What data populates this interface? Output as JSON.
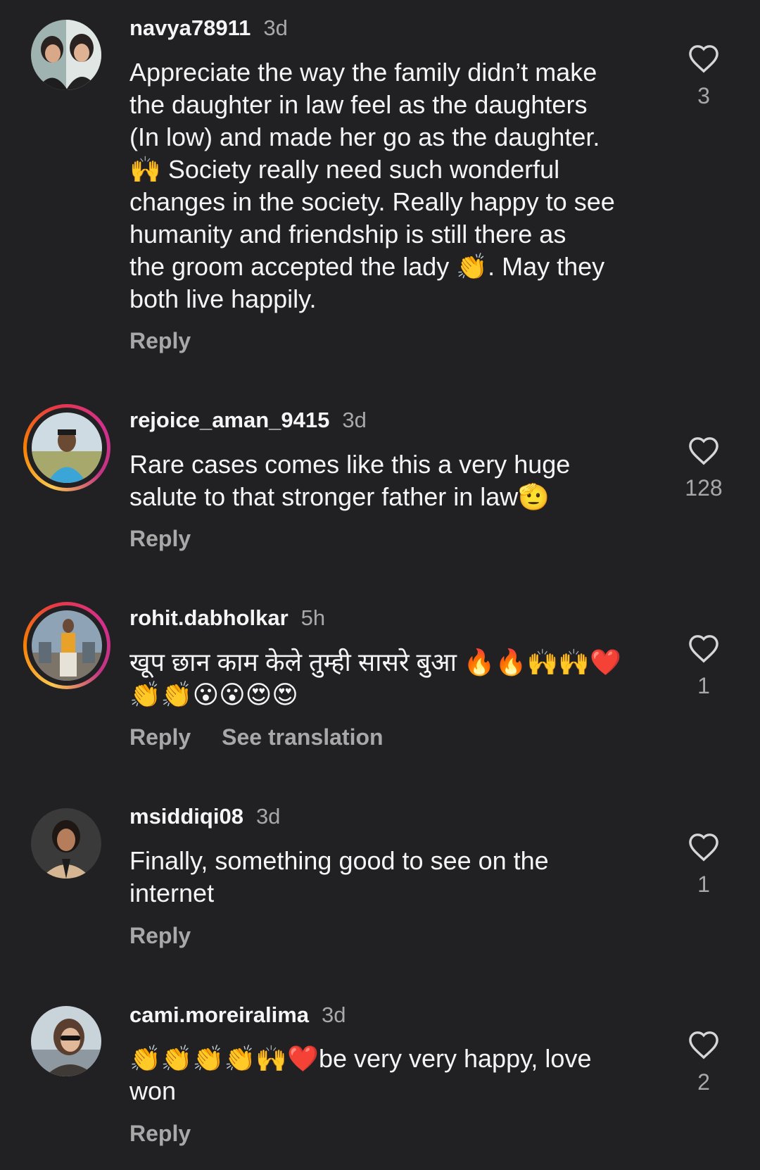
{
  "colors": {
    "background": "#212123",
    "primary_text": "#f5f5f5",
    "secondary_text": "#a8a8a8",
    "story_ring": [
      "#f9c74f",
      "#f77f00",
      "#e63946",
      "#d62f8c"
    ]
  },
  "comments": [
    {
      "username": "navya78911",
      "time": "3d",
      "text": "Appreciate the way the family didn’t make\nthe daughter in law feel as the daughters\n(In low) and made her go as the daughter.\n🙌 Society really need such wonderful\nchanges in the society. Really happy to see\nhumanity and friendship is still there as\nthe groom accepted the lady 👏. May they\nboth live happily.",
      "reply_label": "Reply",
      "likes": "3",
      "avatar_icon": "avatar-two-women-icon"
    },
    {
      "username": "rejoice_aman_9415",
      "time": "3d",
      "text": "Rare cases comes like this a  very huge\nsalute to that stronger father in law🫡",
      "reply_label": "Reply",
      "likes": "128",
      "avatar_icon": "avatar-man-blue-shirt-icon"
    },
    {
      "username": "rohit.dabholkar",
      "time": "5h",
      "text": "खूप छान काम केले तुम्ही सासरे बुआ 🔥🔥🙌🙌❤️\n👏👏😮😮😍😍",
      "reply_label": "Reply",
      "translation_label": "See translation",
      "likes": "1",
      "avatar_icon": "avatar-man-yellow-shirt-icon"
    },
    {
      "username": "msiddiqi08",
      "time": "3d",
      "text": "Finally, something good to see on the\ninternet",
      "reply_label": "Reply",
      "likes": "1",
      "avatar_icon": "avatar-woman-coat-icon"
    },
    {
      "username": "cami.moreiralima",
      "time": "3d",
      "text": "👏👏👏👏🙌❤️be very very happy, love\nwon",
      "reply_label": "Reply",
      "likes": "2",
      "avatar_icon": "avatar-woman-sunglasses-icon"
    }
  ]
}
